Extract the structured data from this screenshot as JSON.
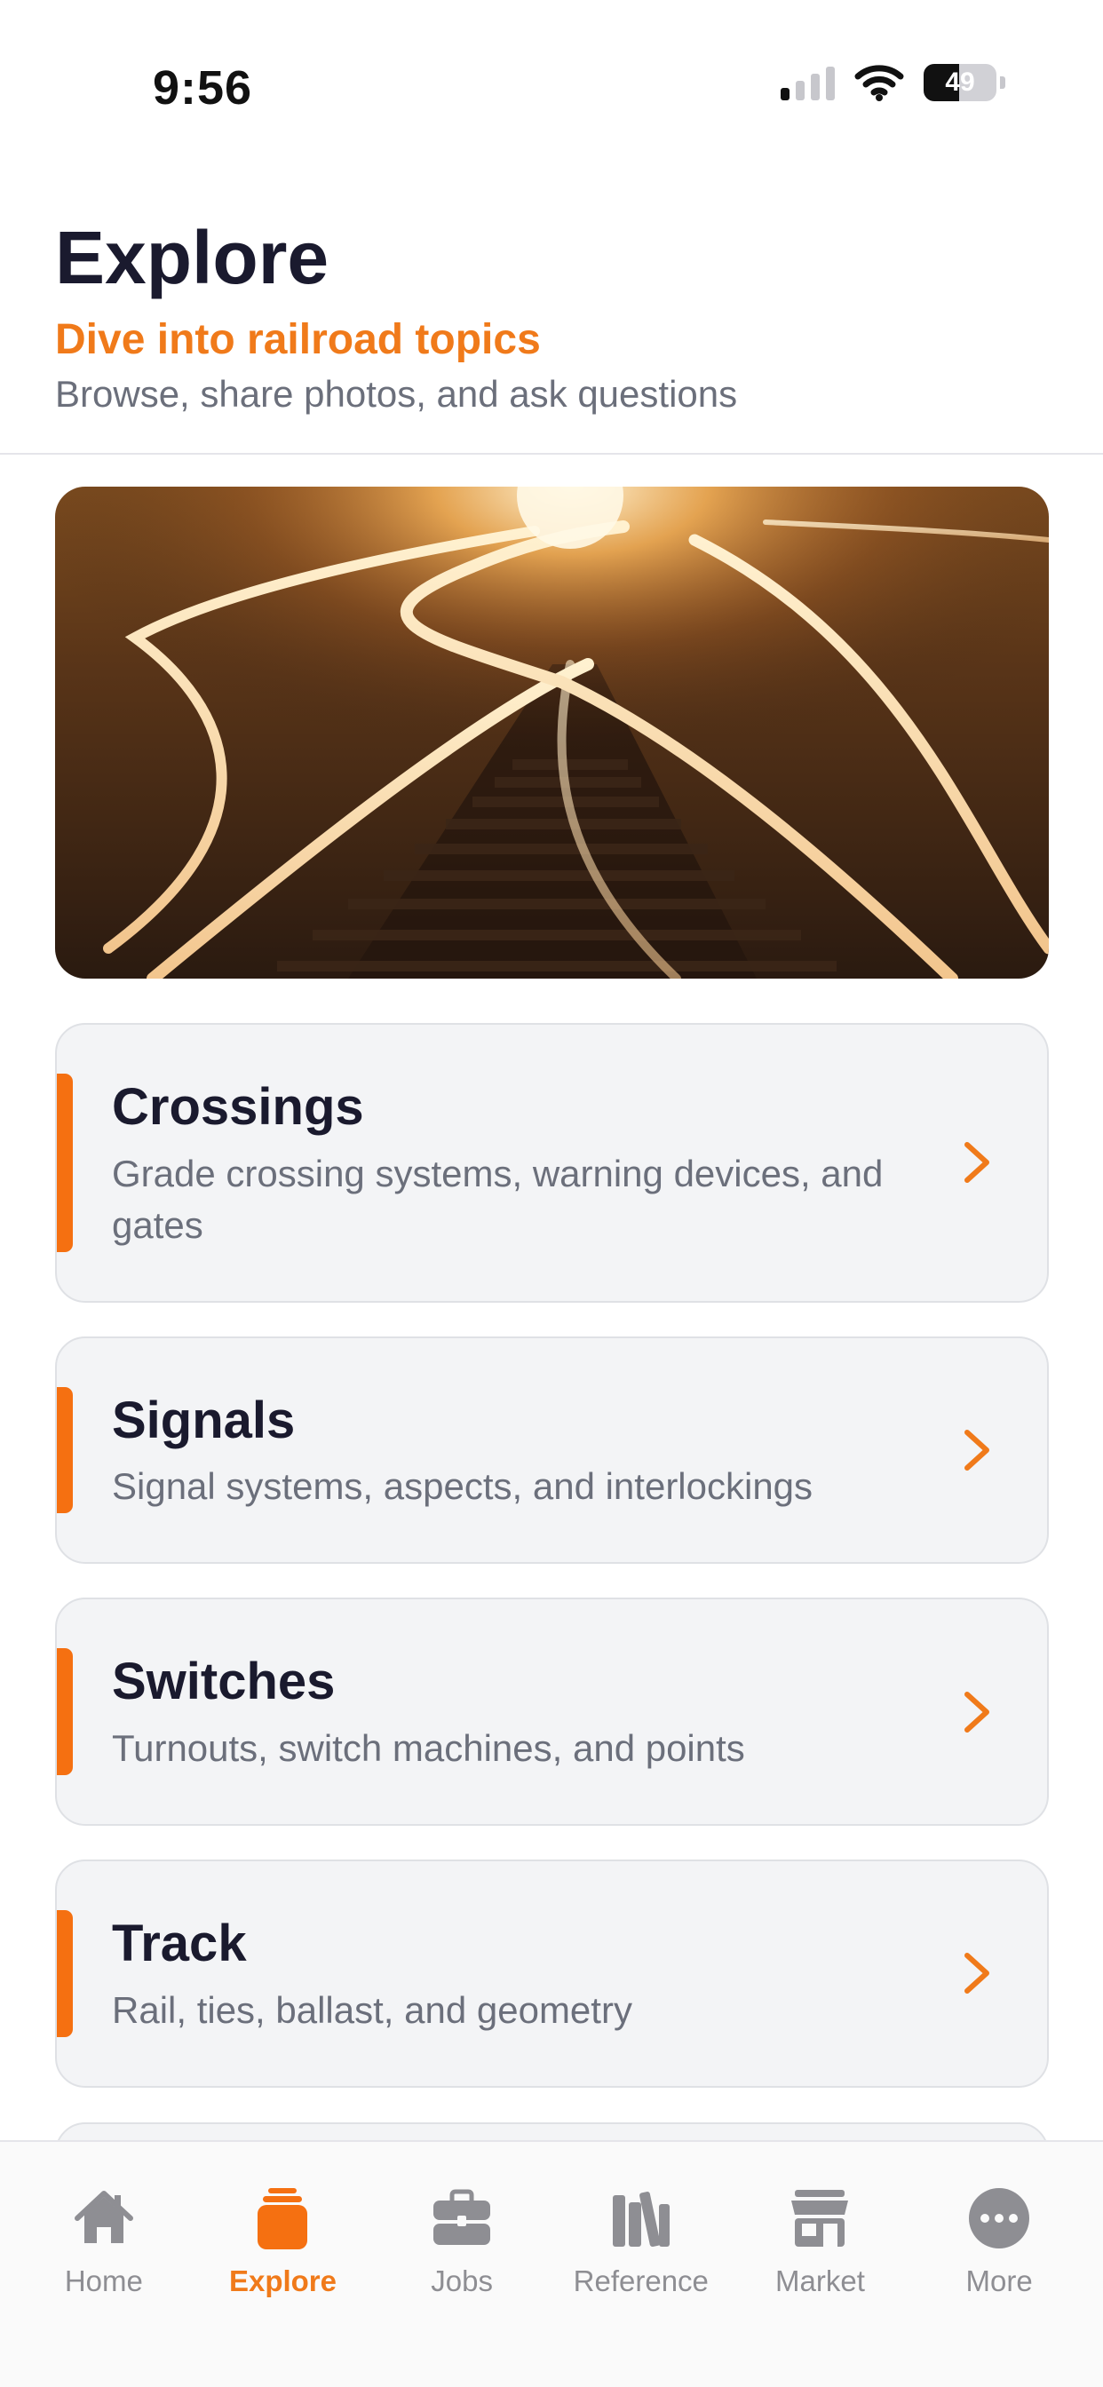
{
  "status_bar": {
    "time": "9:56",
    "battery_level": "49",
    "battery_fraction": 0.49,
    "cell_signal_bars": 1
  },
  "header": {
    "title": "Explore",
    "subtitle": "Dive into railroad topics",
    "description": "Browse, share photos, and ask questions"
  },
  "topics": [
    {
      "title": "Crossings",
      "description": "Grade crossing systems, warning devices, and gates"
    },
    {
      "title": "Signals",
      "description": "Signal systems, aspects, and interlockings"
    },
    {
      "title": "Switches",
      "description": "Turnouts, switch machines, and points"
    },
    {
      "title": "Track",
      "description": "Rail, ties, ballast, and geometry"
    }
  ],
  "tab_bar": {
    "tabs": [
      {
        "label": "Home",
        "icon": "house-icon",
        "active": false
      },
      {
        "label": "Explore",
        "icon": "explore-icon",
        "active": true
      },
      {
        "label": "Jobs",
        "icon": "briefcase-icon",
        "active": false
      },
      {
        "label": "Reference",
        "icon": "books-icon",
        "active": false
      },
      {
        "label": "Market",
        "icon": "storefront-icon",
        "active": false
      },
      {
        "label": "More",
        "icon": "ellipsis-icon",
        "active": false
      }
    ]
  },
  "colors": {
    "accent": "#f07a1a",
    "title": "#1a1a2e",
    "muted": "#6b6f7b",
    "card_bg": "#f3f4f6",
    "inactive_tab": "#8e8e93"
  }
}
